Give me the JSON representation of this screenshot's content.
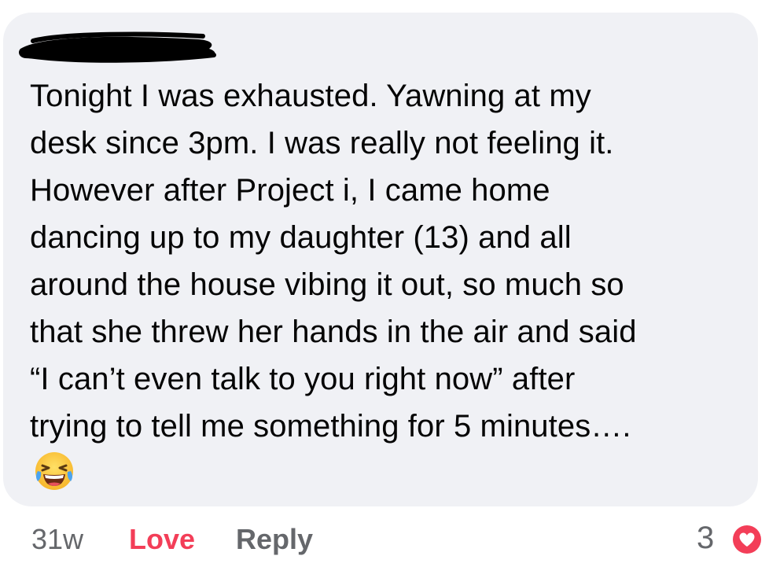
{
  "comment": {
    "author_name_redacted": true,
    "lines": [
      "Tonight I was exhausted.  Yawning at my",
      "desk since 3pm.  I was really not feeling it.",
      "However after Project i, I came home",
      "dancing up to my daughter (13) and all",
      "around the house vibing it out, so much so",
      "that she threw her hands in the air and said",
      "“I can’t even talk to you right now” after",
      "trying to tell me something for 5 minutes…."
    ],
    "emoji": "laughing-with-tears-emoji"
  },
  "actions": {
    "timestamp": "31w",
    "love_label": "Love",
    "reply_label": "Reply"
  },
  "reactions": {
    "count": "3",
    "icon": "heart-reaction-icon",
    "icon_color": "#f33e58"
  },
  "colors": {
    "bubble": "#f0f1f5",
    "text": "#050505",
    "muted": "#65676b",
    "love": "#f33e58"
  }
}
